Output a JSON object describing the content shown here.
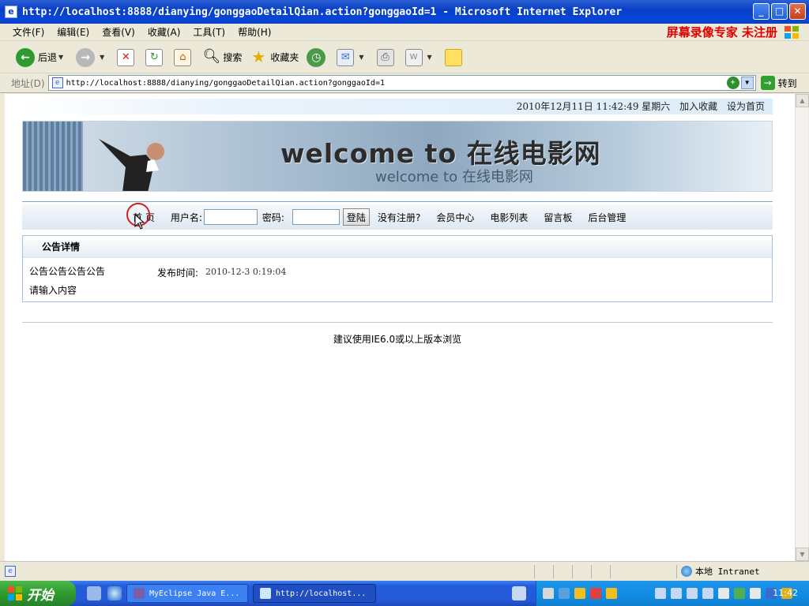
{
  "window": {
    "title": "http://localhost:8888/dianying/gonggaoDetailQian.action?gonggaoId=1 - Microsoft Internet Explorer"
  },
  "menu": {
    "items": [
      "文件(F)",
      "编辑(E)",
      "查看(V)",
      "收藏(A)",
      "工具(T)",
      "帮助(H)"
    ],
    "watermark": "屏幕录像专家 未注册"
  },
  "toolbar": {
    "back_label": "后退",
    "search_label": "搜索",
    "favorites_label": "收藏夹"
  },
  "address": {
    "label": "地址(D)",
    "url": "http://localhost:8888/dianying/gonggaoDetailQian.action?gonggaoId=1",
    "go_label": "转到"
  },
  "page": {
    "topinfo": {
      "datetime": "2010年12月11日 11:42:49 星期六",
      "add_favorite": "加入收藏",
      "set_home": "设为首页"
    },
    "banner": {
      "title": "welcome to 在线电影网",
      "subtitle": "welcome to 在线电影网"
    },
    "nav": {
      "home": "首 页",
      "username_label": "用户名:",
      "password_label": "密码:",
      "login_button": "登陆",
      "register": "没有注册?",
      "member_center": "会员中心",
      "movie_list": "电影列表",
      "guestbook": "留言板",
      "admin": "后台管理"
    },
    "notice": {
      "header": "公告详情",
      "title": "公告公告公告公告",
      "publish_label": "发布时间:",
      "publish_time": "2010-12-3 0:19:04",
      "content": "请输入内容"
    },
    "footer": "建议使用IE6.0或以上版本浏览"
  },
  "statusbar": {
    "zone": "本地 Intranet"
  },
  "taskbar": {
    "start_label": "开始",
    "tasks": [
      "MyEclipse Java E...",
      "http://localhost..."
    ],
    "clock": "11:42"
  },
  "colors": {
    "titlebar": "#0a3fc4",
    "watermark": "#e00000",
    "taskbar": "#245ddb",
    "start": "#2f9a2f"
  }
}
